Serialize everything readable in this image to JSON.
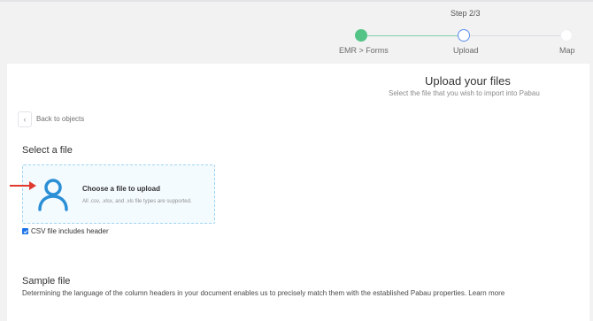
{
  "stepper": {
    "step_label": "Step 2/3",
    "steps": [
      {
        "label": "EMR > Forms",
        "state": "done"
      },
      {
        "label": "Upload",
        "state": "current"
      },
      {
        "label": "Map",
        "state": "todo"
      }
    ]
  },
  "header": {
    "title": "Upload your files",
    "subtitle": "Select the file that you wish to import into Pabau"
  },
  "back": {
    "icon": "chevron-left-icon",
    "label": "Back to objects"
  },
  "select_file": {
    "title": "Select a file",
    "dropzone": {
      "icon": "user-avatar-icon",
      "title": "Choose a file to upload",
      "hint": "All .csv, .xlsx, and .xls file types are supported."
    },
    "csv_header": {
      "label": "CSV file includes header",
      "checked": true
    }
  },
  "sample": {
    "title": "Sample file",
    "description": "Determining the language of the column headers in your document enables us to precisely match them with the established Pabau properties. Learn more"
  },
  "colors": {
    "done": "#54c486",
    "current": "#5b8ef0",
    "dropzone_border": "#9fd4f2",
    "icon": "#2a8fd6",
    "arrow": "#e03a2f"
  }
}
